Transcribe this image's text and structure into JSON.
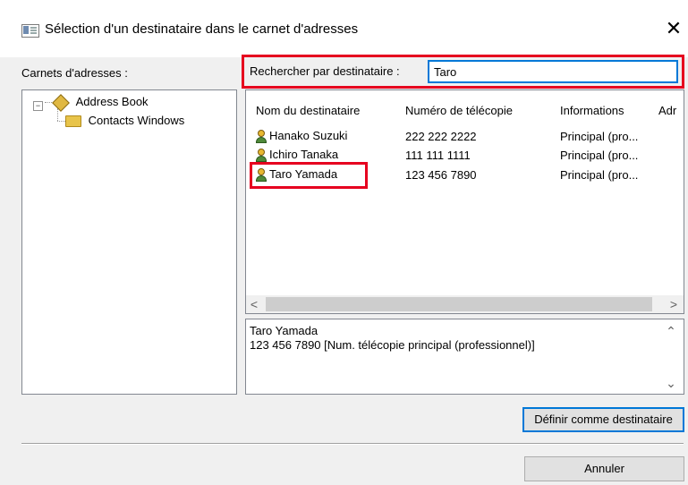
{
  "dialog": {
    "title": "Sélection d'un destinataire dans le carnet d'adresses",
    "close_glyph": "✕"
  },
  "left": {
    "label": "Carnets d'adresses :",
    "tree": [
      {
        "label": "Address Book",
        "icon": "address-book-icon"
      },
      {
        "label": "Contacts Windows",
        "icon": "folder-icon"
      }
    ]
  },
  "search": {
    "label": "Rechercher par destinataire :",
    "value": "Taro"
  },
  "table": {
    "columns": [
      "Nom du destinataire",
      "Numéro de télécopie",
      "Informations",
      "Adr"
    ],
    "rows": [
      {
        "name": "Hanako Suzuki",
        "fax": "222 222 2222",
        "info": "Principal (pro..."
      },
      {
        "name": "Ichiro Tanaka",
        "fax": "111 111 1111",
        "info": "Principal (pro..."
      },
      {
        "name": "Taro Yamada",
        "fax": "123 456 7890",
        "info": "Principal (pro..."
      }
    ],
    "highlighted_row": 2
  },
  "details": {
    "line1": "Taro Yamada",
    "line2": "123 456 7890 [Num. télécopie principal (professionnel)]"
  },
  "buttons": {
    "set_recipient": "Définir comme destinataire",
    "cancel": "Annuler"
  },
  "colors": {
    "highlight_red": "#e6001f",
    "focus_blue": "#0078d7"
  }
}
